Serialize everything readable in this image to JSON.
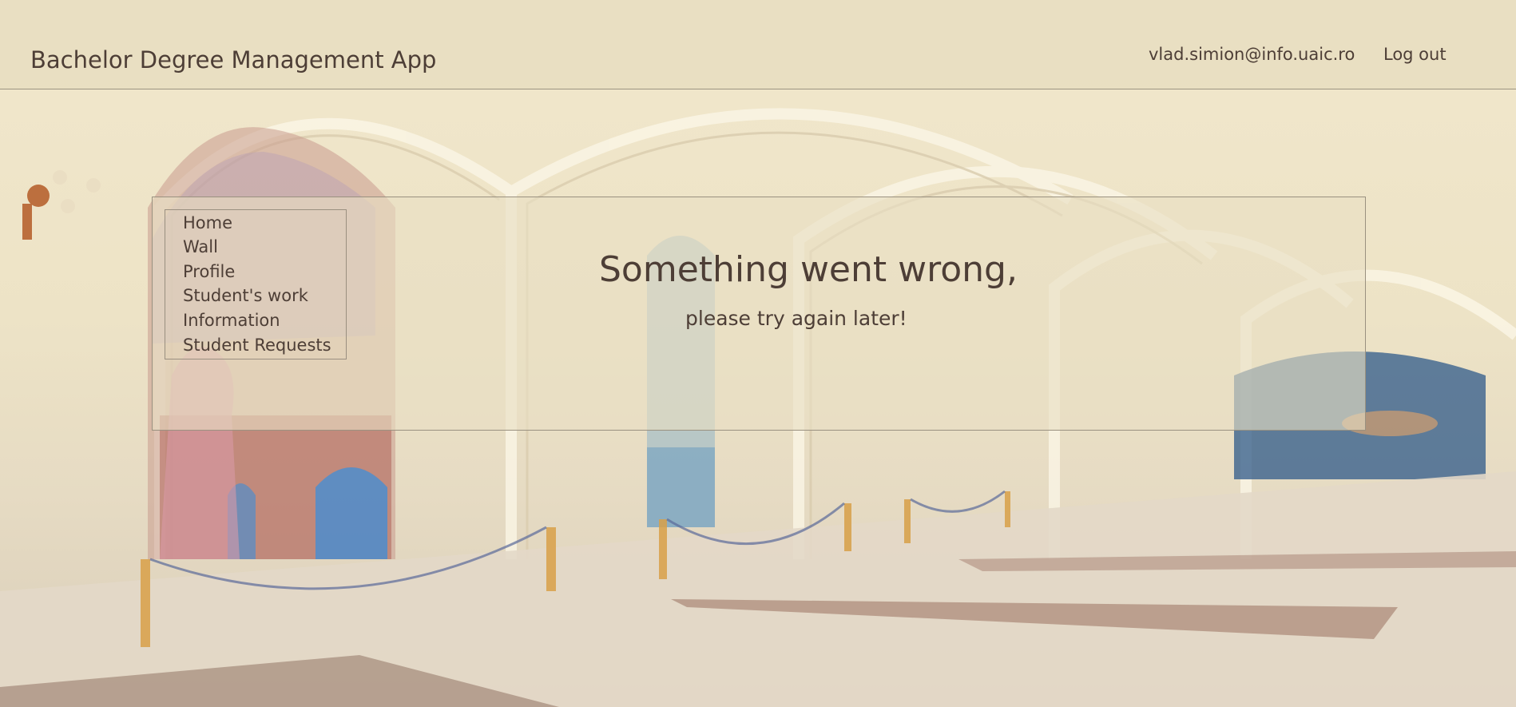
{
  "header": {
    "app_title": "Bachelor Degree Management App",
    "user_email": "vlad.simion@info.uaic.ro",
    "logout_label": "Log out"
  },
  "nav": {
    "items": [
      {
        "label": "Home"
      },
      {
        "label": "Wall"
      },
      {
        "label": "Profile"
      },
      {
        "label": "Student's work"
      },
      {
        "label": "Information"
      },
      {
        "label": "Student Requests"
      }
    ]
  },
  "message": {
    "title": "Something went wrong,",
    "subtitle": "please try again later!"
  },
  "colors": {
    "text": "#4d3e36",
    "header_bg": "#e6dcbe",
    "panel_border": "#9a9180"
  }
}
